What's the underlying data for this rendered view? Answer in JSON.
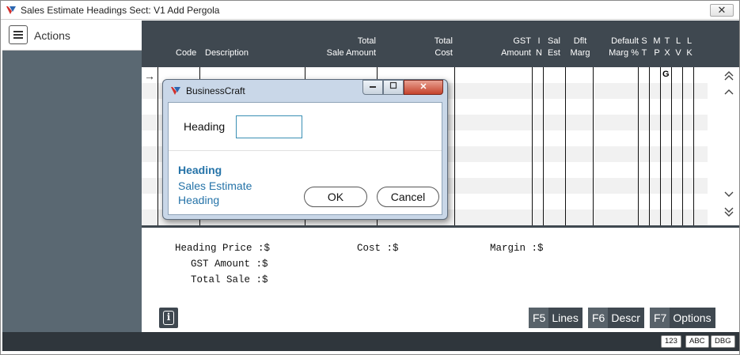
{
  "window": {
    "title": "Sales Estimate Headings  Sect: V1 Add Pergola",
    "close_glyph": "✕"
  },
  "actions": {
    "label": "Actions"
  },
  "grid": {
    "columns": [
      {
        "line1": "",
        "line2": "Code"
      },
      {
        "line1": "",
        "line2": "Description"
      },
      {
        "line1": "Total",
        "line2": "Sale Amount"
      },
      {
        "line1": "Total",
        "line2": "Cost"
      },
      {
        "line1": "GST",
        "line2": "Amount"
      },
      {
        "line1": "I",
        "line2": "N"
      },
      {
        "line1": "Sal",
        "line2": "Est"
      },
      {
        "line1": "Dflt",
        "line2": "Marg"
      },
      {
        "line1": "Default",
        "line2": "Marg %"
      },
      {
        "line1": "S",
        "line2": "T"
      },
      {
        "line1": "M",
        "line2": "P"
      },
      {
        "line1": "T",
        "line2": "X"
      },
      {
        "line1": "L",
        "line2": "V"
      },
      {
        "line1": "L",
        "line2": "K"
      }
    ],
    "row_marker": "→",
    "row_value_g": "G",
    "scroll": {
      "top": "⌃⌃",
      "up": "⌃",
      "down": "⌄",
      "bottom": "⌄⌄"
    }
  },
  "summary": {
    "heading_price": "Heading Price :$",
    "cost": "Cost :$",
    "margin": "Margin :$",
    "gst_amount": "GST Amount :$",
    "total_sale": "Total Sale :$"
  },
  "info_glyph": "i",
  "fkeys": [
    {
      "key": "F5",
      "label": "Lines"
    },
    {
      "key": "F6",
      "label": "Descr"
    },
    {
      "key": "F7",
      "label": "Options"
    }
  ],
  "status_badges": [
    "123",
    "ABC",
    "DBG"
  ],
  "dialog": {
    "title": "BusinessCraft",
    "controls": {
      "min": "▭",
      "max": "□",
      "close": "✕"
    },
    "field_label": "Heading",
    "field_value": "",
    "help_title": "Heading",
    "help_text": "Sales Estimate Heading",
    "ok_label": "OK",
    "cancel_label": "Cancel"
  },
  "colors": {
    "header_bg": "#3f4850",
    "sidebar_bg": "#5a6872",
    "help_text": "#2573a8",
    "input_border": "#3a8fb4"
  }
}
